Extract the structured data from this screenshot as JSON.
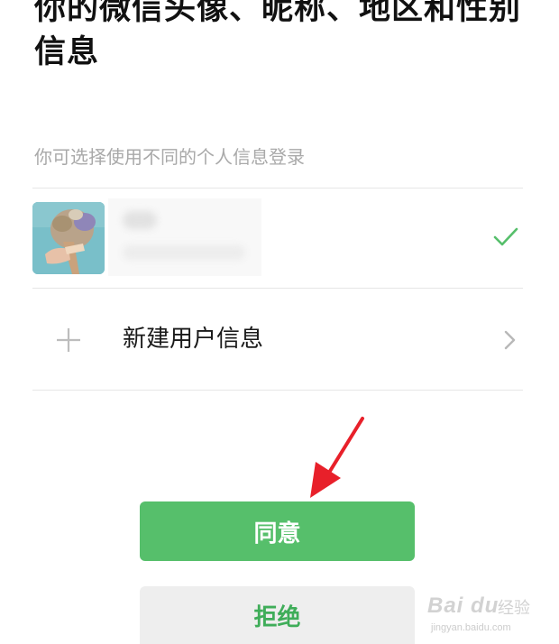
{
  "header": {
    "title": "你的微信头像、昵称、地区和性别信息"
  },
  "profile_select": {
    "hint": "你可选择使用不同的个人信息登录",
    "selected_profile": {
      "avatar_icon": "avatar-photo-icon",
      "check_icon": "checkmark-icon",
      "check_color": "#56bf6b"
    },
    "new_profile": {
      "label": "新建用户信息",
      "left_icon": "plus-icon",
      "right_icon": "chevron-right-icon"
    }
  },
  "actions": {
    "agree_label": "同意",
    "reject_label": "拒绝",
    "agree_color": "#56bf6b",
    "reject_text_color": "#3fad59",
    "reject_bg": "#eeeeee"
  },
  "annotation": {
    "arrow_icon": "red-arrow-icon",
    "arrow_color": "#e8202a"
  },
  "watermark": {
    "logo": "Bai du",
    "product": "经验",
    "url": "jingyan.baidu.com"
  }
}
